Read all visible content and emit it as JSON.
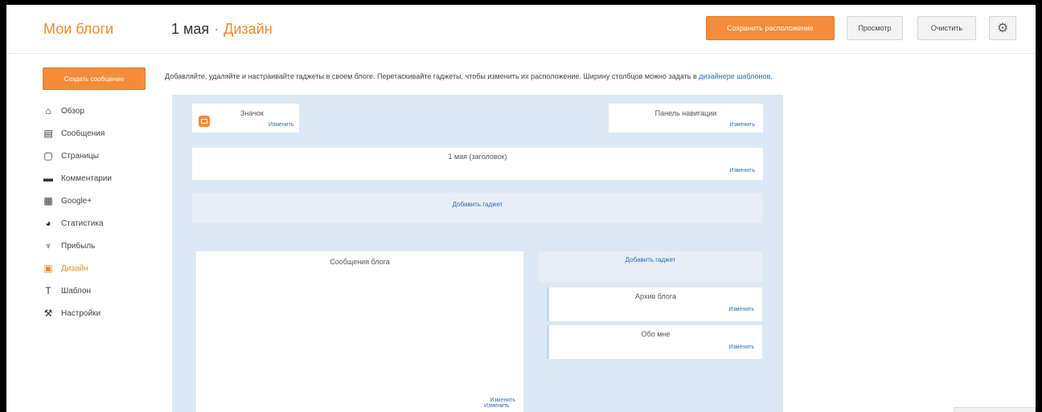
{
  "header": {
    "brand": "Мои блоги",
    "breadcrumb_blog": "1 мая",
    "breadcrumb_sep": "·",
    "breadcrumb_section": "Дизайн",
    "save_label": "Сохранить расположение",
    "preview_label": "Просмотр",
    "clear_label": "Очистить",
    "settings_icon": "gear-icon"
  },
  "sidebar": {
    "create_label": "Создать сообщение",
    "items": [
      {
        "label": "Обзор",
        "icon": "home-icon"
      },
      {
        "label": "Сообщения",
        "icon": "posts-icon"
      },
      {
        "label": "Страницы",
        "icon": "pages-icon"
      },
      {
        "label": "Комментарии",
        "icon": "comments-icon"
      },
      {
        "label": "Google+",
        "icon": "google-plus-icon"
      },
      {
        "label": "Статистика",
        "icon": "stats-icon"
      },
      {
        "label": "Прибыль",
        "icon": "trophy-icon"
      },
      {
        "label": "Дизайн",
        "icon": "layout-icon",
        "active": true
      },
      {
        "label": "Шаблон",
        "icon": "template-icon"
      },
      {
        "label": "Настройки",
        "icon": "wrench-icon"
      }
    ]
  },
  "main": {
    "intro_text": "Добавляйте, удаляйте и настраивайте гаджеты в своем блоге. Перетаскивайте гаджеты, чтобы изменить их расположение. Ширину столбцов можно задать в ",
    "intro_link": "дизайнере шаблонов",
    "intro_end": ".",
    "gadgets": {
      "favicon_title": "Значок",
      "favicon_edit": "Изменить",
      "navbar_title": "Панель навигации",
      "navbar_edit": "Изменить",
      "header_title": "1 мая (заголовок)",
      "header_edit": "Изменить",
      "add_gadget_top": "Добавить гаджет",
      "posts_title": "Сообщения блога",
      "posts_edit": "Изменить",
      "add_gadget_side": "Добавить гаджет",
      "archive_title": "Архив блога",
      "archive_edit": "Изменить",
      "about_title": "Обо мне",
      "about_edit": "Изменить",
      "bottom_edit": "Изменить"
    }
  },
  "colors": {
    "accent": "#f08a2a",
    "link": "#2a6db8",
    "canvas": "#dde8f5"
  }
}
